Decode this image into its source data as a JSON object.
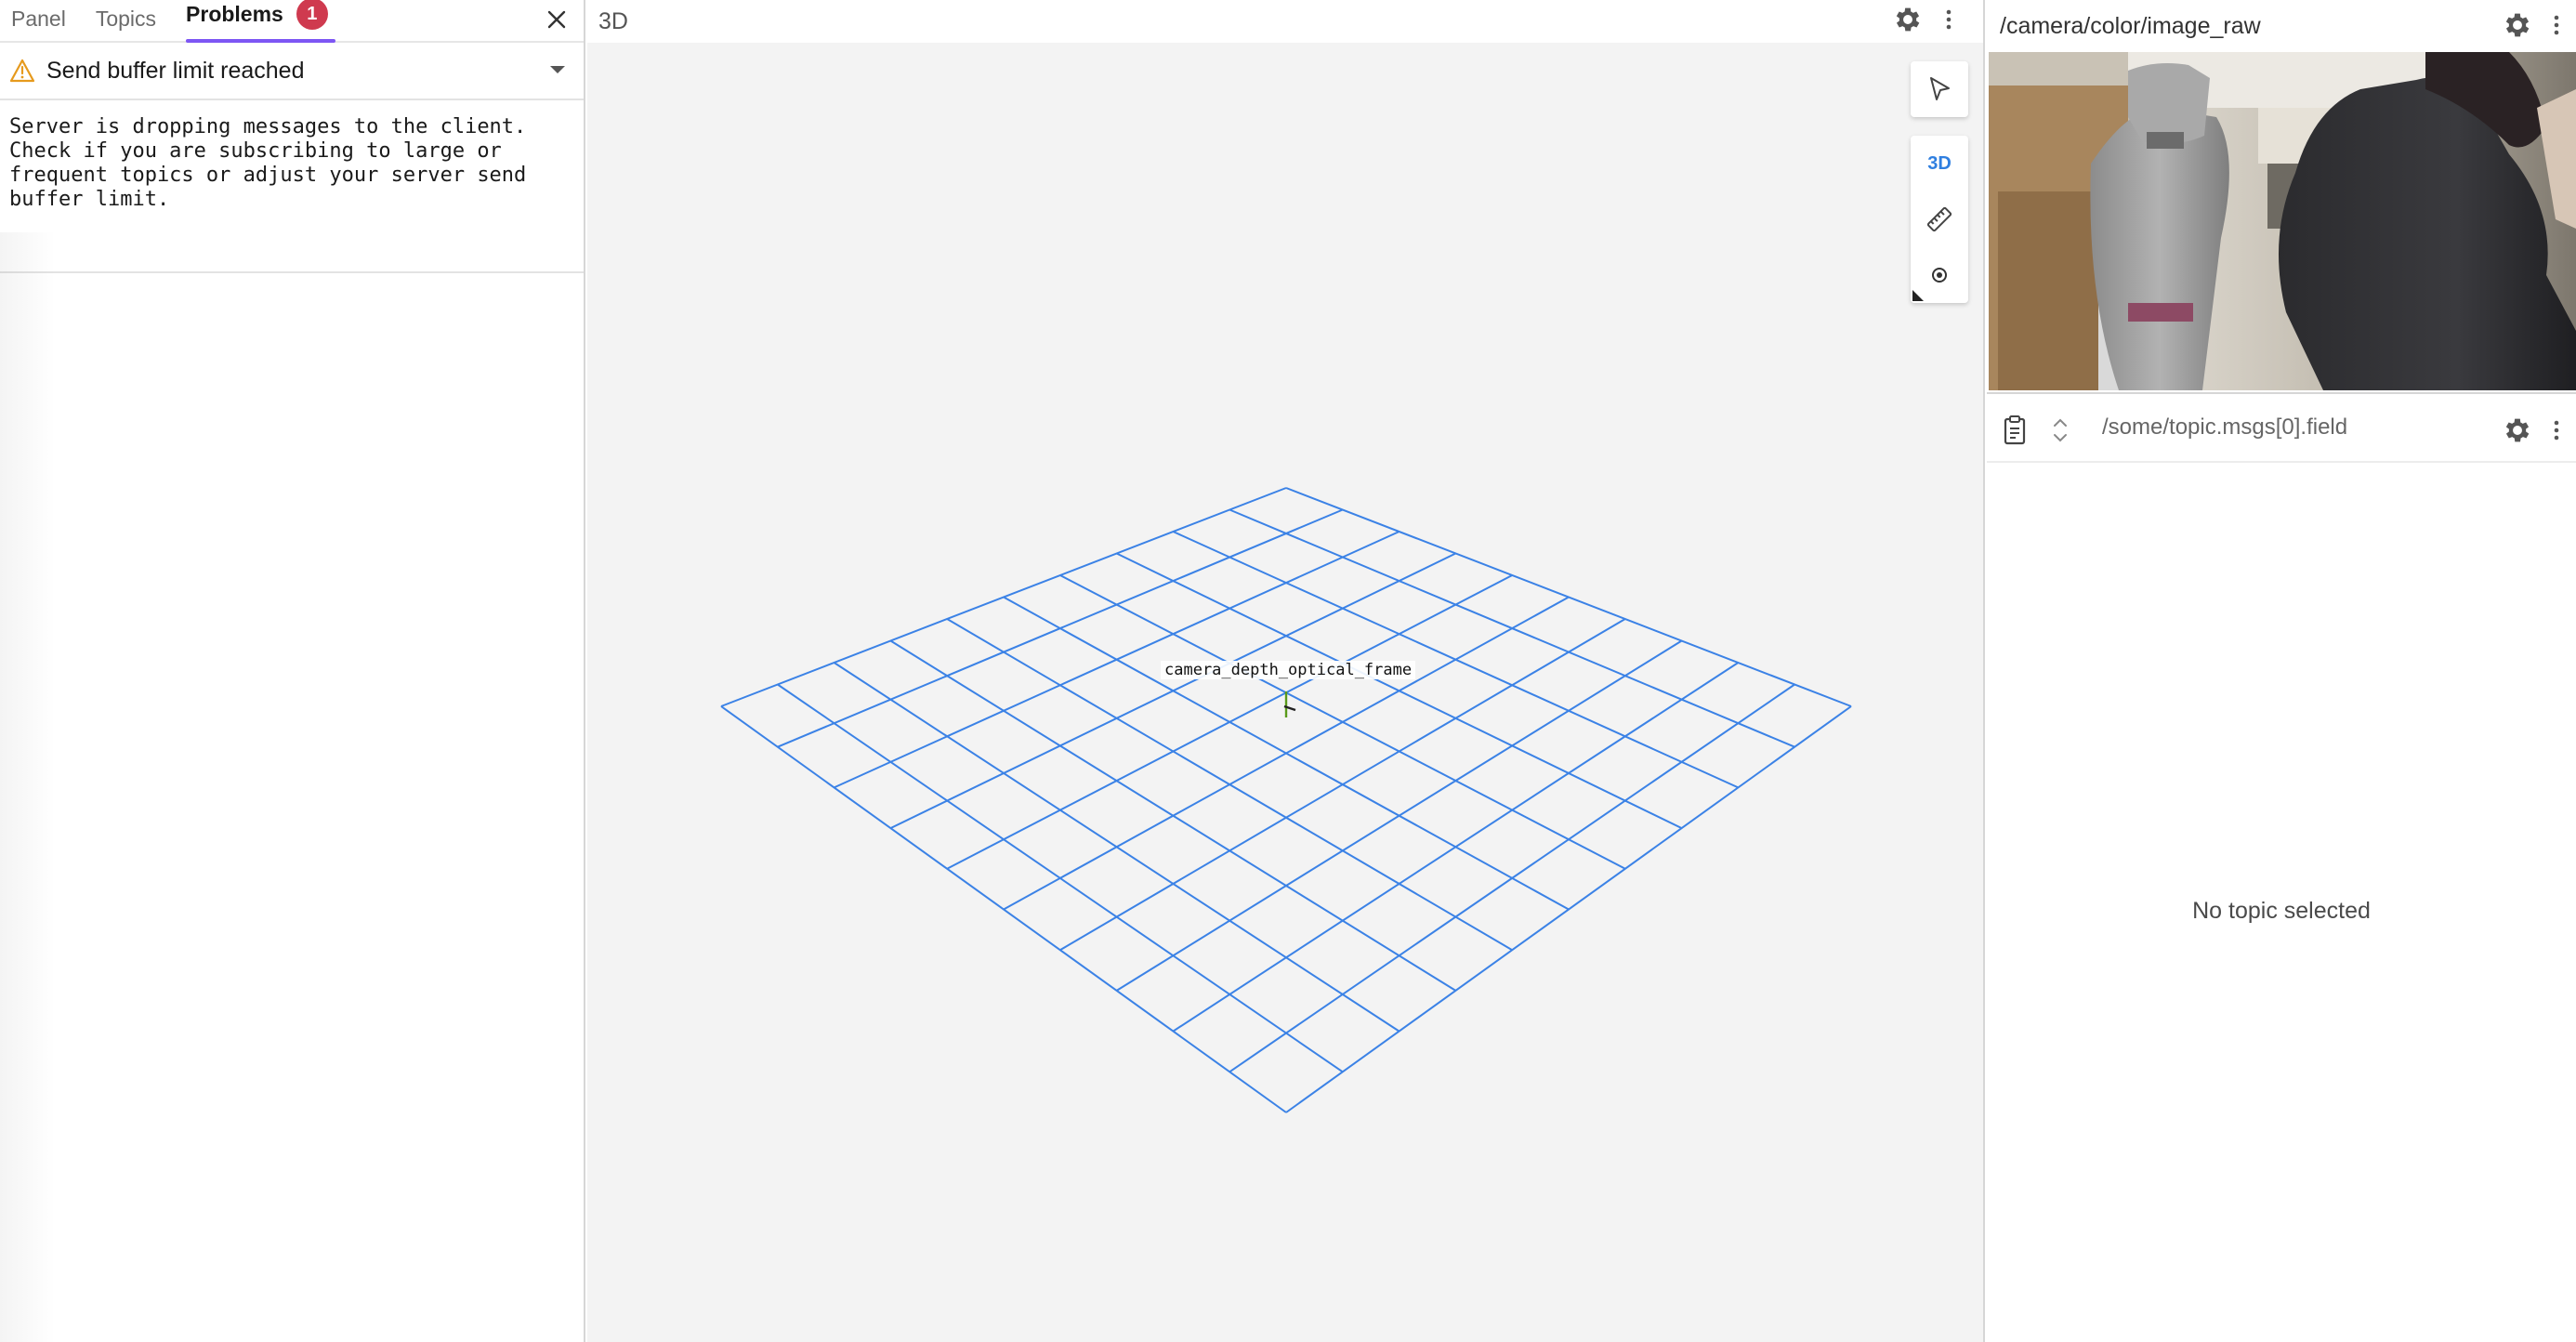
{
  "sidebar": {
    "tabs": [
      {
        "label": "Panel"
      },
      {
        "label": "Topics"
      },
      {
        "label": "Problems",
        "badge": "1"
      }
    ],
    "problem": {
      "title": "Send buffer limit reached",
      "message": "Server is dropping messages to the client.\nCheck if you are subscribing to large or\nfrequent topics or adjust your server send\nbuffer limit."
    }
  },
  "panel3d": {
    "title": "3D",
    "tool_3d_label": "3D",
    "frame_label": "camera_depth_optical_frame",
    "grid_color": "#3b82e6"
  },
  "image_panel": {
    "topic": "/camera/color/image_raw"
  },
  "raw_panel": {
    "path": "/some/topic.msgs[0].field",
    "empty_message": "No topic selected"
  },
  "colors": {
    "accent": "#7d56f4",
    "badge": "#cf3a4f",
    "warning": "#e69a1d"
  }
}
